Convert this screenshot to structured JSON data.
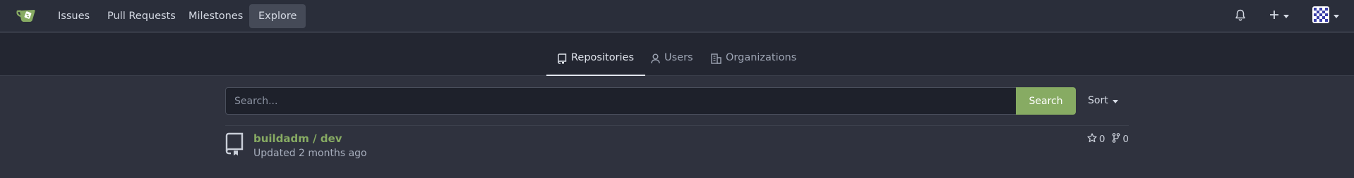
{
  "navbar": {
    "items": [
      {
        "label": "Issues"
      },
      {
        "label": "Pull Requests"
      },
      {
        "label": "Milestones"
      },
      {
        "label": "Explore"
      }
    ],
    "active_item": "Explore",
    "icons": [
      "gitea-logo-icon",
      "bell-icon",
      "plus-icon",
      "avatar"
    ]
  },
  "tabs": [
    {
      "label": "Repositories",
      "icon": "repo-icon"
    },
    {
      "label": "Users",
      "icon": "person-icon"
    },
    {
      "label": "Organizations",
      "icon": "organization-icon"
    }
  ],
  "active_tab": "Repositories",
  "search": {
    "placeholder": "Search...",
    "value": "",
    "button_label": "Search"
  },
  "sort": {
    "label": "Sort"
  },
  "repos": [
    {
      "title": "buildadm / dev",
      "updated": "Updated 2 months ago",
      "stars": "0",
      "forks": "0"
    }
  ],
  "colors": {
    "accent": "#87ab63",
    "background": "#2f323e",
    "navbar": "#2a2e3a",
    "subheader": "#232631"
  }
}
